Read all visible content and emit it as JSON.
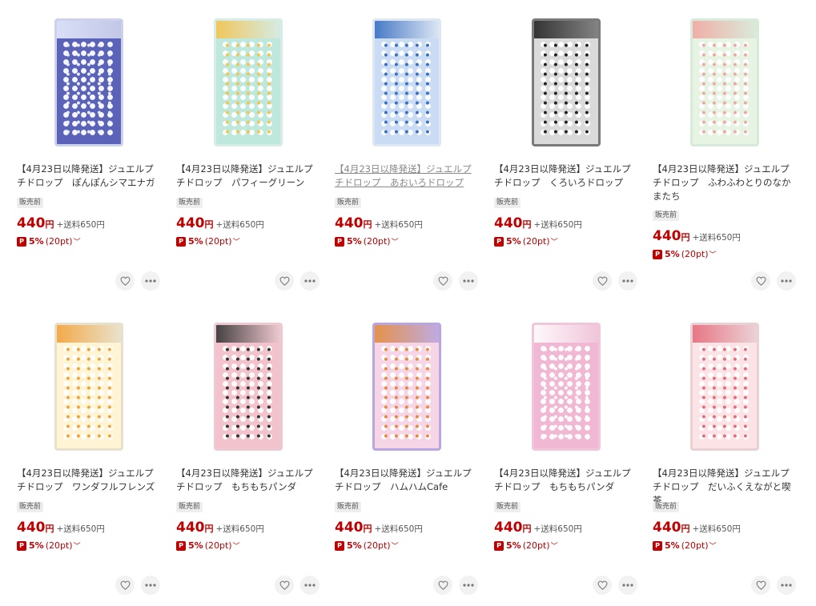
{
  "badge_text": "販売前",
  "currency_label": "円",
  "shipping_text": "+送料650円",
  "point_text": "5%",
  "point_sub": "(20pt)",
  "colors": {
    "price": "#bf0000",
    "badge_bg": "#eeeeee"
  },
  "products": [
    {
      "title": "【4月23日以降発送】ジュエルプチドロップ　ぽんぽんシマエナガ",
      "price": "440",
      "theme": {
        "bg": "#5a63b8",
        "accent": "#e8ecff",
        "border": "#cdd2ec"
      }
    },
    {
      "title": "【4月23日以降発送】ジュエルプチドロップ　パフィーグリーン",
      "price": "440",
      "theme": {
        "bg": "#bfe8dc",
        "accent": "#f6c34d",
        "border": "#d7ece4"
      }
    },
    {
      "title": "【4月23日以降発送】ジュエルプチドロップ　あおいろドロップ",
      "price": "440",
      "theme": {
        "bg": "#c9dcf3",
        "accent": "#3a6fc1",
        "border": "#dde6f3"
      }
    },
    {
      "title": "【4月23日以降発送】ジュエルプチドロップ　くろいろドロップ",
      "price": "440",
      "theme": {
        "bg": "#dadada",
        "accent": "#222222",
        "border": "#7a7a7a"
      }
    },
    {
      "title": "【4月23日以降発送】ジュエルプチドロップ　ふわふわとりのなかまたち",
      "price": "440",
      "theme": {
        "bg": "#e7f3e3",
        "accent": "#f0a7a0",
        "border": "#d8ead9"
      }
    },
    {
      "title": "【4月23日以降発送】ジュエルプチドロップ　ワンダフルフレンズ",
      "price": "440",
      "theme": {
        "bg": "#fff4d4",
        "accent": "#f1a23a",
        "border": "#e6e0cc"
      }
    },
    {
      "title": "【4月23日以降発送】ジュエルプチドロップ　もちもちパンダ",
      "price": "440",
      "theme": {
        "bg": "#f2c3cc",
        "accent": "#333333",
        "border": "#efc9d1"
      }
    },
    {
      "title": "【4月23日以降発送】ジュエルプチドロップ　ハムハムCafe",
      "price": "440",
      "theme": {
        "bg": "#f6d6e6",
        "accent": "#e38a3b",
        "border": "#b9a6e0"
      }
    },
    {
      "title": "【4月23日以降発送】ジュエルプチドロップ　もちもちパンダ",
      "price": "440",
      "theme": {
        "bg": "#f1b8d3",
        "accent": "#ffffff",
        "border": "#f0c7da"
      }
    },
    {
      "title": "【4月23日以降発送】ジュエルプチドロップ　だいふくえながと喫茶",
      "price": "440",
      "theme": {
        "bg": "#fbe3e6",
        "accent": "#e56b7a",
        "border": "#e9d0d4"
      }
    }
  ]
}
